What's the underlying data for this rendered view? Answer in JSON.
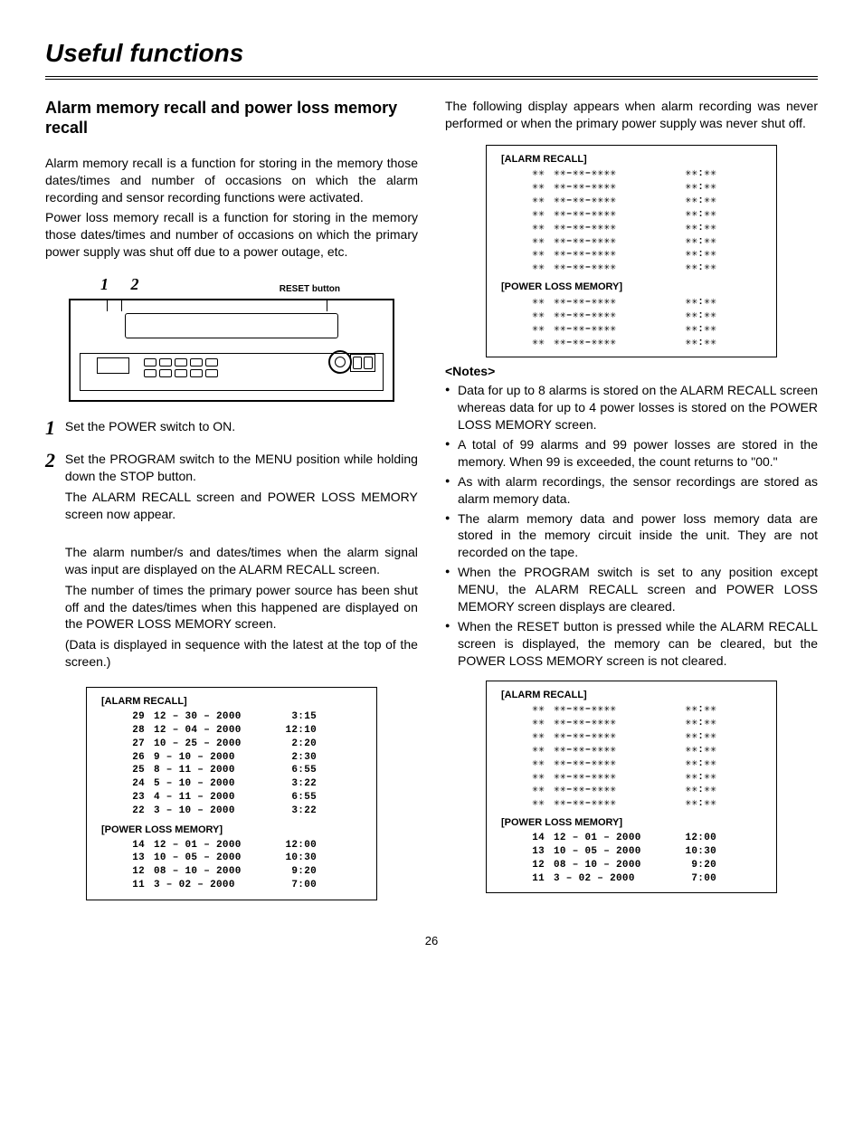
{
  "page_title": "Useful functions",
  "page_number": "26",
  "left": {
    "heading": "Alarm memory recall and power loss memory recall",
    "para1": "Alarm memory recall is a function for storing in the memory those dates/times and number of occasions on which the alarm recording and sensor recording functions were activated.",
    "para2": "Power loss memory recall is a function for storing in the memory those dates/times and number of occasions on which the primary power supply was shut off due to a power outage, etc.",
    "diagram_labels": {
      "nums": "1 2",
      "reset": "RESET button"
    },
    "step1": "Set the POWER switch to ON.",
    "step2a": "Set the PROGRAM switch to the MENU position while holding down the STOP button.",
    "step2b": "The ALARM RECALL screen and POWER LOSS MEMORY screen now appear.",
    "step2c": "The alarm number/s and dates/times when the alarm signal was input are displayed on the ALARM RECALL screen.",
    "step2d": "The number of times the primary power source has been shut off and the dates/times when this happened are displayed on the POWER LOSS MEMORY screen.",
    "step2e": "(Data is displayed in sequence with the latest at the top of the screen.)",
    "screen1": {
      "alarm_header": "[ALARM RECALL]",
      "alarm_rows": [
        [
          "29",
          "12 – 30 – 2000",
          "3:15"
        ],
        [
          "28",
          "12 – 04 – 2000",
          "12:10"
        ],
        [
          "27",
          "10 – 25 – 2000",
          "2:20"
        ],
        [
          "26",
          "9 – 10 – 2000",
          "2:30"
        ],
        [
          "25",
          "8 – 11 – 2000",
          "6:55"
        ],
        [
          "24",
          "5 – 10 – 2000",
          "3:22"
        ],
        [
          "23",
          "4 – 11 – 2000",
          "6:55"
        ],
        [
          "22",
          "3 – 10 – 2000",
          "3:22"
        ]
      ],
      "power_header": "[POWER LOSS MEMORY]",
      "power_rows": [
        [
          "14",
          "12 – 01 – 2000",
          "12:00"
        ],
        [
          "13",
          "10 – 05 – 2000",
          "10:30"
        ],
        [
          "12",
          "08 – 10 – 2000",
          "9:20"
        ],
        [
          "11",
          "3 – 02 – 2000",
          "7:00"
        ]
      ]
    }
  },
  "right": {
    "intro": "The following display appears when alarm recording was never performed or when the primary power supply was never shut off.",
    "screen_empty": {
      "alarm_header": "[ALARM RECALL]",
      "alarm_rows": [
        [
          "✳✳",
          "✳✳–✳✳–✳✳✳✳",
          "✳✳:✳✳"
        ],
        [
          "✳✳",
          "✳✳–✳✳–✳✳✳✳",
          "✳✳:✳✳"
        ],
        [
          "✳✳",
          "✳✳–✳✳–✳✳✳✳",
          "✳✳:✳✳"
        ],
        [
          "✳✳",
          "✳✳–✳✳–✳✳✳✳",
          "✳✳:✳✳"
        ],
        [
          "✳✳",
          "✳✳–✳✳–✳✳✳✳",
          "✳✳:✳✳"
        ],
        [
          "✳✳",
          "✳✳–✳✳–✳✳✳✳",
          "✳✳:✳✳"
        ],
        [
          "✳✳",
          "✳✳–✳✳–✳✳✳✳",
          "✳✳:✳✳"
        ],
        [
          "✳✳",
          "✳✳–✳✳–✳✳✳✳",
          "✳✳:✳✳"
        ]
      ],
      "power_header": "[POWER LOSS MEMORY]",
      "power_rows": [
        [
          "✳✳",
          "✳✳–✳✳–✳✳✳✳",
          "✳✳:✳✳"
        ],
        [
          "✳✳",
          "✳✳–✳✳–✳✳✳✳",
          "✳✳:✳✳"
        ],
        [
          "✳✳",
          "✳✳–✳✳–✳✳✳✳",
          "✳✳:✳✳"
        ],
        [
          "✳✳",
          "✳✳–✳✳–✳✳✳✳",
          "✳✳:✳✳"
        ]
      ]
    },
    "notes_head": "<Notes>",
    "notes": [
      "Data for up to 8 alarms is stored on the ALARM RECALL screen whereas data for up to 4 power losses is stored on the POWER LOSS MEMORY screen.",
      "A total of 99 alarms and 99 power losses are stored in the memory.\nWhen 99 is exceeded, the count returns to \"00.\"",
      "As with alarm recordings, the sensor recordings are stored as alarm memory data.",
      "The alarm memory data and power loss memory data are stored in the memory circuit inside the unit. They are not recorded on the tape.",
      "When the PROGRAM switch is set to any position except MENU, the ALARM RECALL screen and POWER LOSS MEMORY screen displays are cleared.",
      "When the RESET button is pressed while the ALARM RECALL screen is displayed, the memory can be cleared, but the POWER LOSS MEMORY screen is not cleared."
    ],
    "screen_partial": {
      "alarm_header": "[ALARM RECALL]",
      "alarm_rows": [
        [
          "✳✳",
          "✳✳–✳✳–✳✳✳✳",
          "✳✳:✳✳"
        ],
        [
          "✳✳",
          "✳✳–✳✳–✳✳✳✳",
          "✳✳:✳✳"
        ],
        [
          "✳✳",
          "✳✳–✳✳–✳✳✳✳",
          "✳✳:✳✳"
        ],
        [
          "✳✳",
          "✳✳–✳✳–✳✳✳✳",
          "✳✳:✳✳"
        ],
        [
          "✳✳",
          "✳✳–✳✳–✳✳✳✳",
          "✳✳:✳✳"
        ],
        [
          "✳✳",
          "✳✳–✳✳–✳✳✳✳",
          "✳✳:✳✳"
        ],
        [
          "✳✳",
          "✳✳–✳✳–✳✳✳✳",
          "✳✳:✳✳"
        ],
        [
          "✳✳",
          "✳✳–✳✳–✳✳✳✳",
          "✳✳:✳✳"
        ]
      ],
      "power_header": "[POWER LOSS MEMORY]",
      "power_rows": [
        [
          "14",
          "12 – 01 – 2000",
          "12:00"
        ],
        [
          "13",
          "10 – 05 – 2000",
          "10:30"
        ],
        [
          "12",
          "08 – 10 – 2000",
          "9:20"
        ],
        [
          "11",
          "3 – 02 – 2000",
          "7:00"
        ]
      ]
    }
  }
}
